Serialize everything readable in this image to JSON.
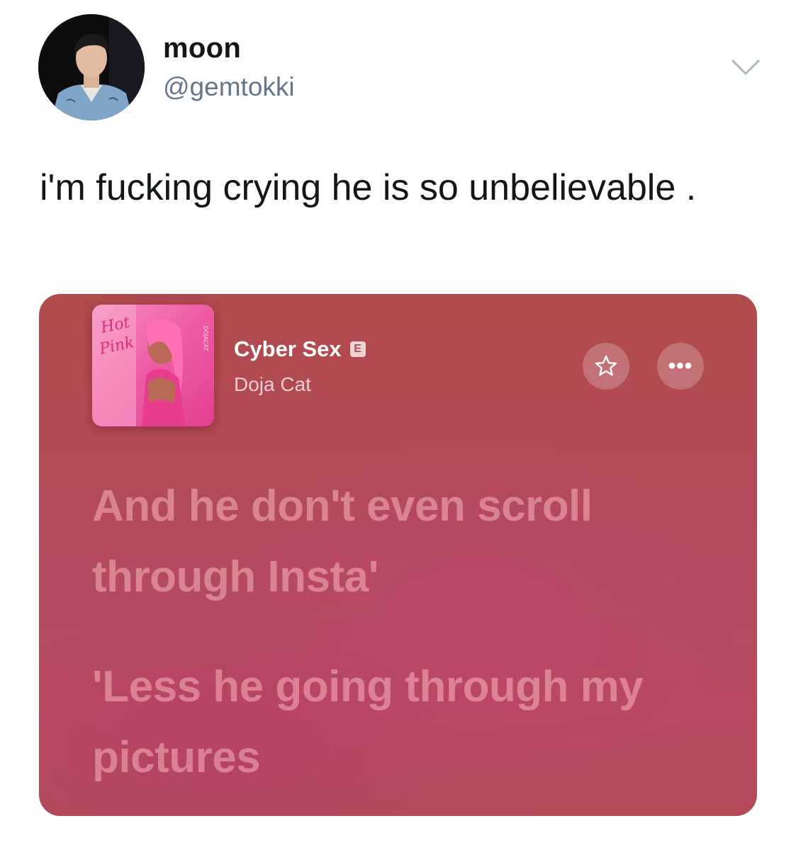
{
  "tweet": {
    "author": {
      "display_name": "moon",
      "handle": "@gemtokki",
      "avatar_icon": "profile-photo"
    },
    "menu_icon": "chevron-down-icon",
    "text": "i'm fucking crying he is so unbelievable ."
  },
  "media": {
    "song": {
      "title": "Cyber Sex",
      "explicit_badge": "E",
      "artist": "Doja Cat",
      "album_art_icon": "album-cover",
      "album_art_text": "Hot Pink",
      "album_art_side_text": "D O J A C A T"
    },
    "buttons": {
      "favorite_icon": "star-icon",
      "more_label": "•••"
    },
    "lyrics": [
      "And he don't even scroll through Insta'",
      "'Less he going through my pictures"
    ],
    "colors": {
      "background": "#b24a56",
      "lyric_text": "#f0a4ac",
      "title_text": "#ffffff"
    }
  }
}
